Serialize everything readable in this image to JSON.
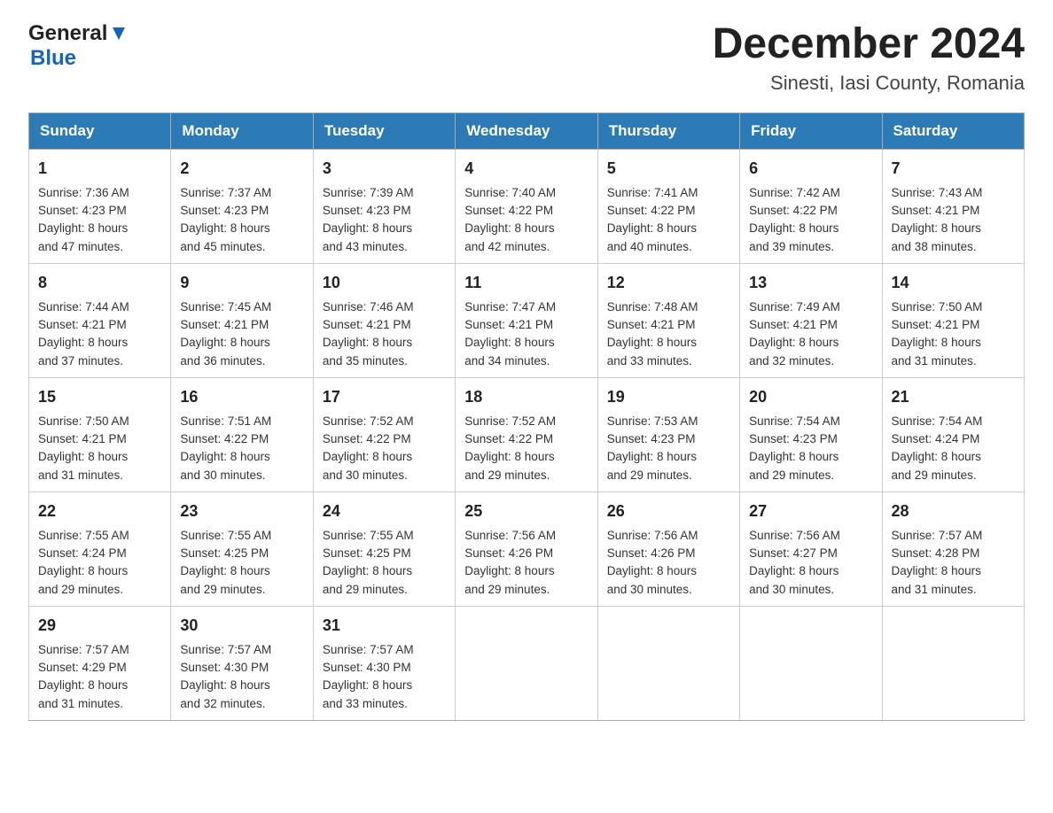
{
  "header": {
    "month_title": "December 2024",
    "location": "Sinesti, Iasi County, Romania",
    "logo_general": "General",
    "logo_blue": "Blue"
  },
  "days_of_week": [
    "Sunday",
    "Monday",
    "Tuesday",
    "Wednesday",
    "Thursday",
    "Friday",
    "Saturday"
  ],
  "weeks": [
    [
      {
        "day": "1",
        "sunrise": "7:36 AM",
        "sunset": "4:23 PM",
        "daylight": "8 hours and 47 minutes."
      },
      {
        "day": "2",
        "sunrise": "7:37 AM",
        "sunset": "4:23 PM",
        "daylight": "8 hours and 45 minutes."
      },
      {
        "day": "3",
        "sunrise": "7:39 AM",
        "sunset": "4:23 PM",
        "daylight": "8 hours and 43 minutes."
      },
      {
        "day": "4",
        "sunrise": "7:40 AM",
        "sunset": "4:22 PM",
        "daylight": "8 hours and 42 minutes."
      },
      {
        "day": "5",
        "sunrise": "7:41 AM",
        "sunset": "4:22 PM",
        "daylight": "8 hours and 40 minutes."
      },
      {
        "day": "6",
        "sunrise": "7:42 AM",
        "sunset": "4:22 PM",
        "daylight": "8 hours and 39 minutes."
      },
      {
        "day": "7",
        "sunrise": "7:43 AM",
        "sunset": "4:21 PM",
        "daylight": "8 hours and 38 minutes."
      }
    ],
    [
      {
        "day": "8",
        "sunrise": "7:44 AM",
        "sunset": "4:21 PM",
        "daylight": "8 hours and 37 minutes."
      },
      {
        "day": "9",
        "sunrise": "7:45 AM",
        "sunset": "4:21 PM",
        "daylight": "8 hours and 36 minutes."
      },
      {
        "day": "10",
        "sunrise": "7:46 AM",
        "sunset": "4:21 PM",
        "daylight": "8 hours and 35 minutes."
      },
      {
        "day": "11",
        "sunrise": "7:47 AM",
        "sunset": "4:21 PM",
        "daylight": "8 hours and 34 minutes."
      },
      {
        "day": "12",
        "sunrise": "7:48 AM",
        "sunset": "4:21 PM",
        "daylight": "8 hours and 33 minutes."
      },
      {
        "day": "13",
        "sunrise": "7:49 AM",
        "sunset": "4:21 PM",
        "daylight": "8 hours and 32 minutes."
      },
      {
        "day": "14",
        "sunrise": "7:50 AM",
        "sunset": "4:21 PM",
        "daylight": "8 hours and 31 minutes."
      }
    ],
    [
      {
        "day": "15",
        "sunrise": "7:50 AM",
        "sunset": "4:21 PM",
        "daylight": "8 hours and 31 minutes."
      },
      {
        "day": "16",
        "sunrise": "7:51 AM",
        "sunset": "4:22 PM",
        "daylight": "8 hours and 30 minutes."
      },
      {
        "day": "17",
        "sunrise": "7:52 AM",
        "sunset": "4:22 PM",
        "daylight": "8 hours and 30 minutes."
      },
      {
        "day": "18",
        "sunrise": "7:52 AM",
        "sunset": "4:22 PM",
        "daylight": "8 hours and 29 minutes."
      },
      {
        "day": "19",
        "sunrise": "7:53 AM",
        "sunset": "4:23 PM",
        "daylight": "8 hours and 29 minutes."
      },
      {
        "day": "20",
        "sunrise": "7:54 AM",
        "sunset": "4:23 PM",
        "daylight": "8 hours and 29 minutes."
      },
      {
        "day": "21",
        "sunrise": "7:54 AM",
        "sunset": "4:24 PM",
        "daylight": "8 hours and 29 minutes."
      }
    ],
    [
      {
        "day": "22",
        "sunrise": "7:55 AM",
        "sunset": "4:24 PM",
        "daylight": "8 hours and 29 minutes."
      },
      {
        "day": "23",
        "sunrise": "7:55 AM",
        "sunset": "4:25 PM",
        "daylight": "8 hours and 29 minutes."
      },
      {
        "day": "24",
        "sunrise": "7:55 AM",
        "sunset": "4:25 PM",
        "daylight": "8 hours and 29 minutes."
      },
      {
        "day": "25",
        "sunrise": "7:56 AM",
        "sunset": "4:26 PM",
        "daylight": "8 hours and 29 minutes."
      },
      {
        "day": "26",
        "sunrise": "7:56 AM",
        "sunset": "4:26 PM",
        "daylight": "8 hours and 30 minutes."
      },
      {
        "day": "27",
        "sunrise": "7:56 AM",
        "sunset": "4:27 PM",
        "daylight": "8 hours and 30 minutes."
      },
      {
        "day": "28",
        "sunrise": "7:57 AM",
        "sunset": "4:28 PM",
        "daylight": "8 hours and 31 minutes."
      }
    ],
    [
      {
        "day": "29",
        "sunrise": "7:57 AM",
        "sunset": "4:29 PM",
        "daylight": "8 hours and 31 minutes."
      },
      {
        "day": "30",
        "sunrise": "7:57 AM",
        "sunset": "4:30 PM",
        "daylight": "8 hours and 32 minutes."
      },
      {
        "day": "31",
        "sunrise": "7:57 AM",
        "sunset": "4:30 PM",
        "daylight": "8 hours and 33 minutes."
      },
      null,
      null,
      null,
      null
    ]
  ],
  "labels": {
    "sunrise": "Sunrise:",
    "sunset": "Sunset:",
    "daylight": "Daylight:"
  }
}
